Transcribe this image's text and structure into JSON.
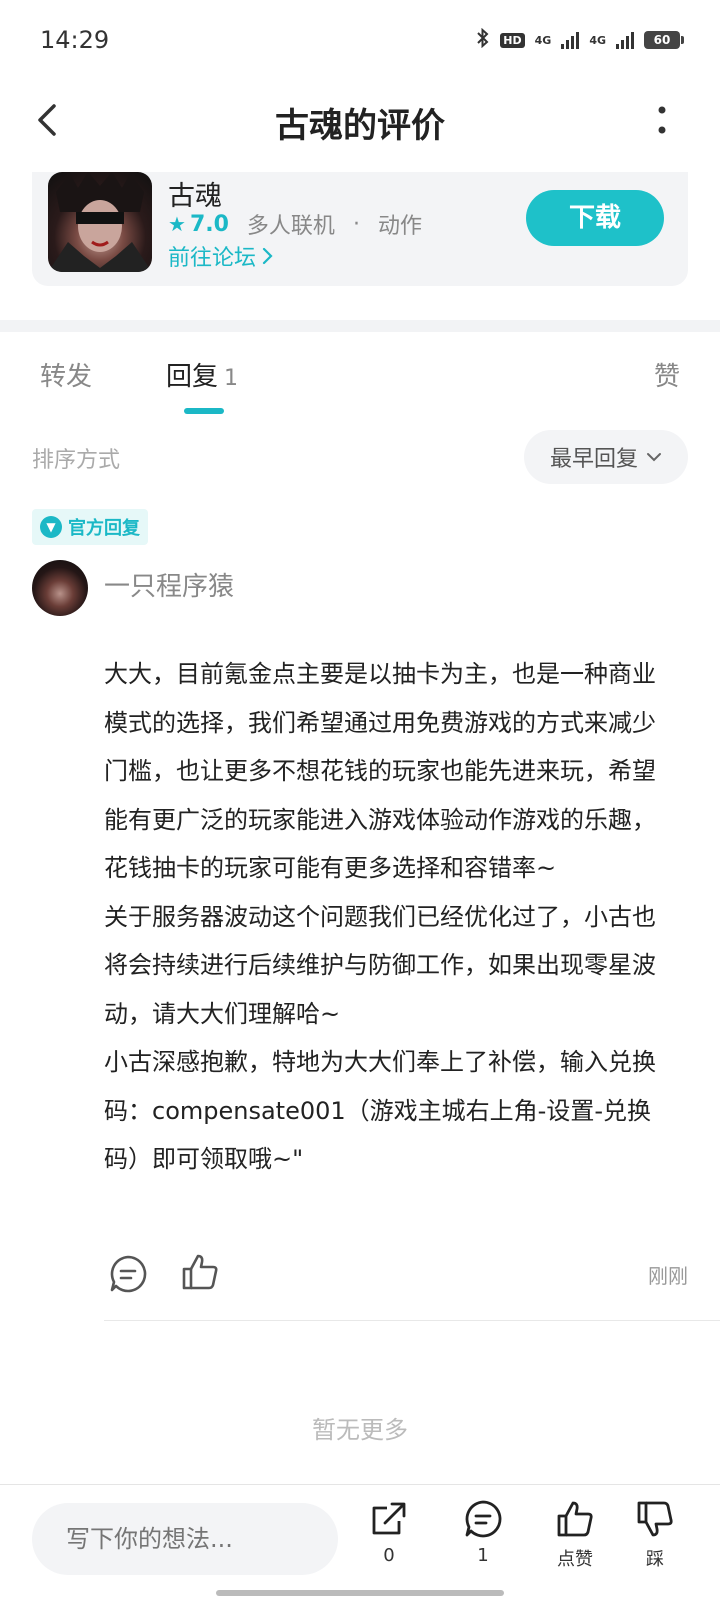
{
  "status_bar": {
    "time": "14:29",
    "network_1": "4G",
    "network_2": "4G",
    "hd": "HD",
    "battery": "60"
  },
  "nav": {
    "title": "古魂的评价"
  },
  "game": {
    "name": "古魂",
    "rating": "7.0",
    "tag_1": "多人联机",
    "separator": "·",
    "tag_2": "动作",
    "forum_link": "前往论坛",
    "download_label": "下载"
  },
  "tabs": {
    "forward": "转发",
    "reply": "回复",
    "reply_count": "1",
    "like": "赞"
  },
  "sort": {
    "label": "排序方式",
    "selected": "最早回复"
  },
  "reply": {
    "badge": "官方回复",
    "username": "一只程序猿",
    "paragraphs": [
      "大大，目前氪金点主要是以抽卡为主，也是一种商业模式的选择，我们希望通过用免费游戏的方式来减少门槛，也让更多不想花钱的玩家也能先进来玩，希望能有更广泛的玩家能进入游戏体验动作游戏的乐趣，花钱抽卡的玩家可能有更多选择和容错率~",
      "关于服务器波动这个问题我们已经优化过了，小古也将会持续进行后续维护与防御工作，如果出现零星波动，请大大们理解哈~",
      "小古深感抱歉，特地为大大们奉上了补偿，输入兑换码：compensate001（游戏主城右上角-设置-兑换码）即可领取哦~\""
    ],
    "time": "刚刚"
  },
  "footer": {
    "no_more": "暂无更多"
  },
  "bottom_bar": {
    "input_placeholder": "写下你的想法...",
    "share_count": "0",
    "comment_count": "1",
    "like_label": "点赞",
    "dislike_label": "踩"
  },
  "colors": {
    "accent": "#1bb8c6",
    "download_bg": "#1ec1c9"
  }
}
